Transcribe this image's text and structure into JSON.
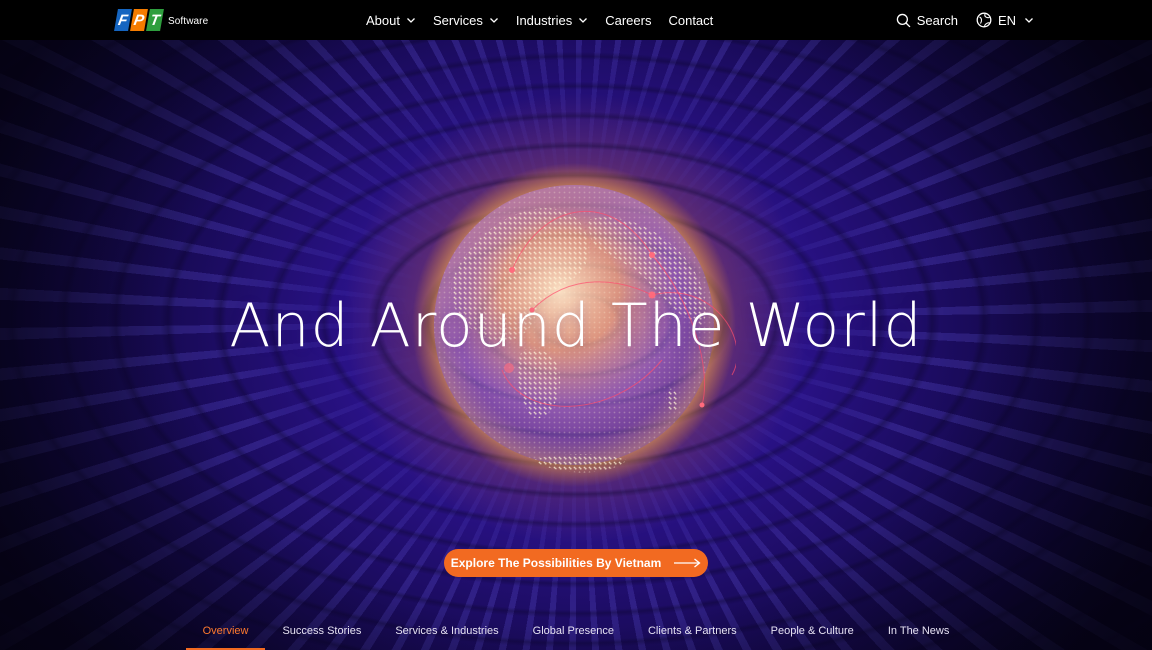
{
  "header": {
    "logo": {
      "letters": [
        "F",
        "P",
        "T"
      ],
      "subtitle": "Software"
    },
    "nav": [
      {
        "label": "About",
        "has_dropdown": true
      },
      {
        "label": "Services",
        "has_dropdown": true
      },
      {
        "label": "Industries",
        "has_dropdown": true
      },
      {
        "label": "Careers",
        "has_dropdown": false
      },
      {
        "label": "Contact",
        "has_dropdown": false
      }
    ],
    "search_label": "Search",
    "language_label": "EN"
  },
  "hero": {
    "headline": "And Around The World",
    "cta_label": "Explore The Possibilities By Vietnam"
  },
  "tabs": [
    {
      "label": "Overview",
      "active": true
    },
    {
      "label": "Success Stories",
      "active": false
    },
    {
      "label": "Services & Industries",
      "active": false
    },
    {
      "label": "Global Presence",
      "active": false
    },
    {
      "label": "Clients & Partners",
      "active": false
    },
    {
      "label": "People & Culture",
      "active": false
    },
    {
      "label": "In The News",
      "active": false
    }
  ],
  "colors": {
    "accent": "#f26a21",
    "topbar": "#000000",
    "hero_deep": "#1a0b5c",
    "glow": "#ffa028"
  },
  "icons": {
    "search": "search-icon",
    "language": "globe-icon",
    "dropdown": "chevron-down-icon",
    "cta": "arrow-right-icon"
  }
}
